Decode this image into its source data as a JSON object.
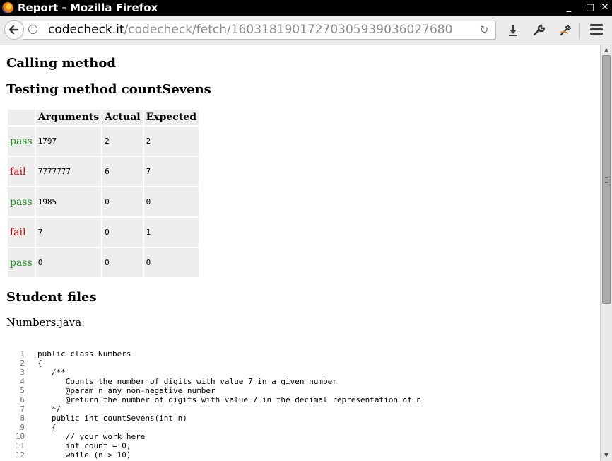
{
  "window": {
    "title": "Report - Mozilla Firefox",
    "controls": [
      "_",
      "□",
      "✕"
    ]
  },
  "toolbar": {
    "url_host": "codecheck.it",
    "url_path": "/codecheck/fetch/16031819017270305939036027680",
    "icons": [
      "back-icon",
      "info-icon",
      "reload-icon",
      "download-icon",
      "wrench-icon",
      "eyedropper-icon",
      "menu-icon"
    ]
  },
  "content": {
    "heading_calling": "Calling method",
    "heading_testing": "Testing method countSevens",
    "table": {
      "headers": [
        "",
        "Arguments",
        "Actual",
        "Expected"
      ],
      "rows": [
        {
          "status": "pass",
          "arguments": "1797",
          "actual": "2",
          "expected": "2"
        },
        {
          "status": "fail",
          "arguments": "7777777",
          "actual": "6",
          "expected": "7"
        },
        {
          "status": "pass",
          "arguments": "1985",
          "actual": "0",
          "expected": "0"
        },
        {
          "status": "fail",
          "arguments": "7",
          "actual": "0",
          "expected": "1"
        },
        {
          "status": "pass",
          "arguments": "0",
          "actual": "0",
          "expected": "0"
        }
      ]
    },
    "heading_student_files": "Student files",
    "filename": "Numbers.java:",
    "code": [
      {
        "num": "1",
        "text": "public class Numbers"
      },
      {
        "num": "2",
        "text": "{"
      },
      {
        "num": "3",
        "text": "   /**"
      },
      {
        "num": "4",
        "text": "      Counts the number of digits with value 7 in a given number"
      },
      {
        "num": "5",
        "text": "      @param n any non-negative number"
      },
      {
        "num": "6",
        "text": "      @return the number of digits with value 7 in the decimal representation of n"
      },
      {
        "num": "7",
        "text": "   */"
      },
      {
        "num": "8",
        "text": "   public int countSevens(int n)"
      },
      {
        "num": "9",
        "text": "   {"
      },
      {
        "num": "10",
        "text": "      // your work here"
      },
      {
        "num": "11",
        "text": "      int count = 0;"
      },
      {
        "num": "12",
        "text": "      while (n > 10)"
      }
    ]
  },
  "colors": {
    "pass": "#228b22",
    "fail": "#e00000",
    "cell_bg": "#eeeeee"
  }
}
